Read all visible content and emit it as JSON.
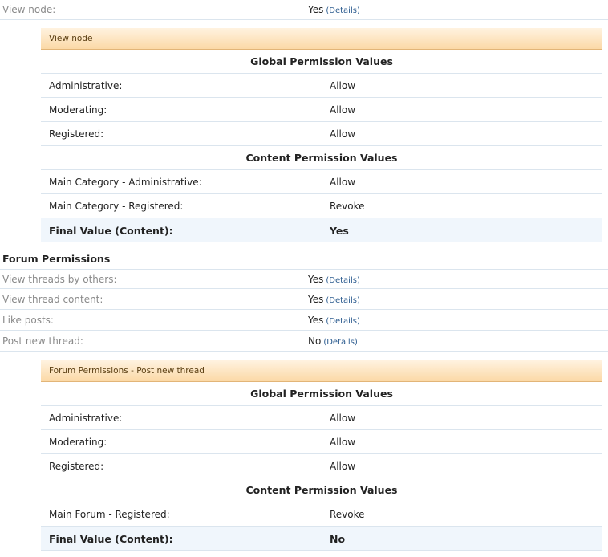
{
  "view_node_row": {
    "label": "View node:",
    "value": "Yes",
    "details": "(Details)"
  },
  "view_node_panel": {
    "title": "View node",
    "global_heading": "Global Permission Values",
    "global_rows": [
      {
        "label": "Administrative:",
        "value": "Allow"
      },
      {
        "label": "Moderating:",
        "value": "Allow"
      },
      {
        "label": "Registered:",
        "value": "Allow"
      }
    ],
    "content_heading": "Content Permission Values",
    "content_rows": [
      {
        "label": "Main Category - Administrative:",
        "value": "Allow"
      },
      {
        "label": "Main Category - Registered:",
        "value": "Revoke"
      }
    ],
    "final": {
      "label": "Final Value (Content):",
      "value": "Yes"
    }
  },
  "forum_section": {
    "heading": "Forum Permissions",
    "rows": [
      {
        "label": "View threads by others:",
        "value": "Yes",
        "details": "(Details)"
      },
      {
        "label": "View thread content:",
        "value": "Yes",
        "details": "(Details)"
      },
      {
        "label": "Like posts:",
        "value": "Yes",
        "details": "(Details)"
      },
      {
        "label": "Post new thread:",
        "value": "No",
        "details": "(Details)"
      }
    ]
  },
  "post_thread_panel": {
    "title": "Forum Permissions - Post new thread",
    "global_heading": "Global Permission Values",
    "global_rows": [
      {
        "label": "Administrative:",
        "value": "Allow"
      },
      {
        "label": "Moderating:",
        "value": "Allow"
      },
      {
        "label": "Registered:",
        "value": "Allow"
      }
    ],
    "content_heading": "Content Permission Values",
    "content_rows": [
      {
        "label": "Main Forum - Registered:",
        "value": "Revoke"
      }
    ],
    "final": {
      "label": "Final Value (Content):",
      "value": "No"
    }
  }
}
